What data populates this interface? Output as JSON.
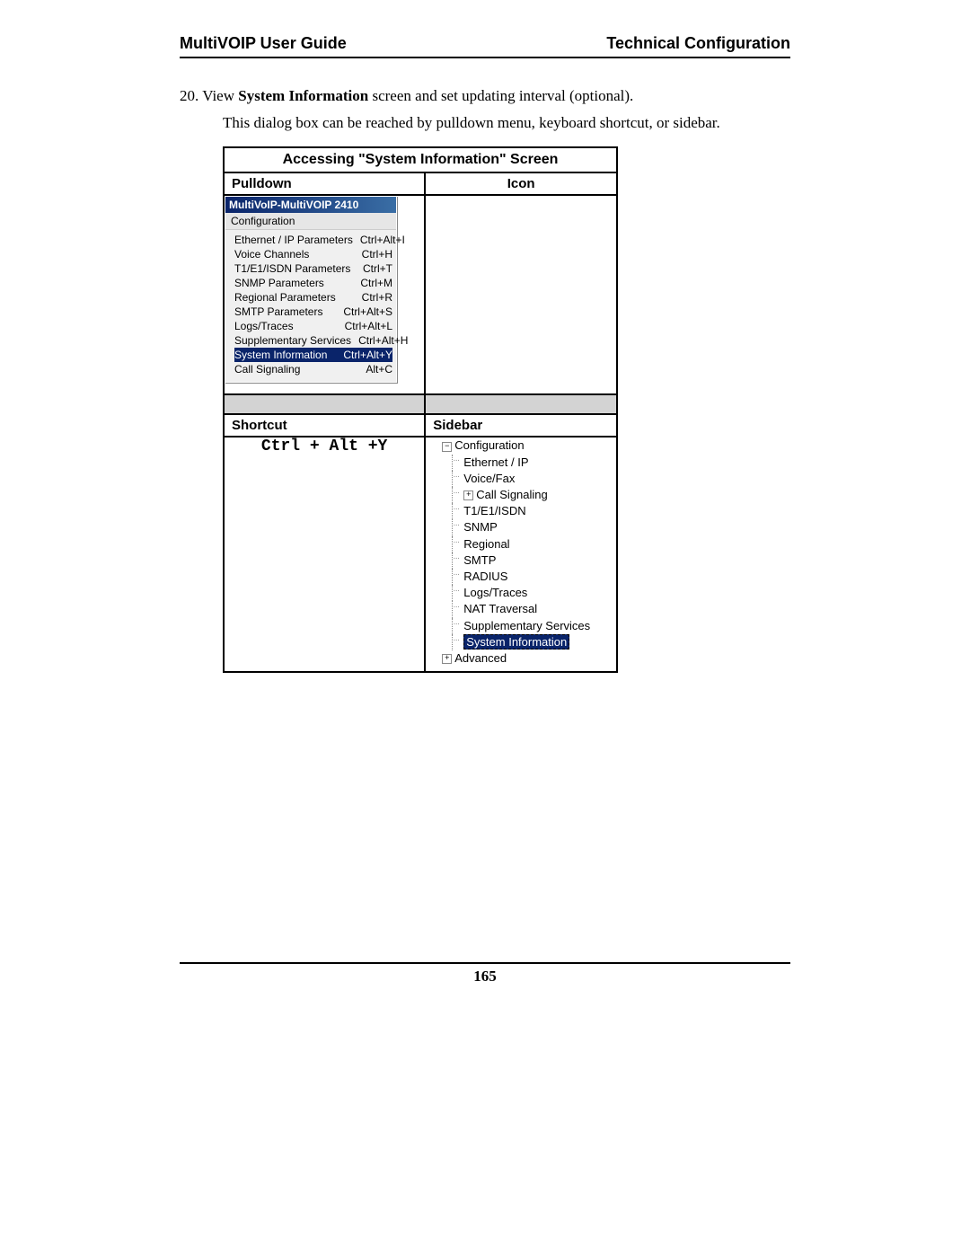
{
  "header": {
    "left": "MultiVOIP User Guide",
    "right": "Technical Configuration"
  },
  "step": {
    "number": "20.",
    "text_prefix": "View ",
    "bold": "System Information",
    "text_suffix": " screen and set updating interval (optional).",
    "desc": "This dialog box can be reached by pulldown menu, keyboard shortcut, or sidebar."
  },
  "table": {
    "caption": "Accessing \"System Information\" Screen",
    "heads": {
      "pulldown": "Pulldown",
      "icon": "Icon",
      "shortcut": "Shortcut",
      "sidebar": "Sidebar"
    },
    "shortcut_value": "Ctrl + Alt +Y"
  },
  "pulldown": {
    "title": "MultiVoIP-MultiVOIP 2410",
    "menu": "Configuration",
    "items": [
      {
        "label": "Ethernet / IP Parameters",
        "shortcut": "Ctrl+Alt+I",
        "selected": false
      },
      {
        "label": "Voice Channels",
        "shortcut": "Ctrl+H",
        "selected": false
      },
      {
        "label": "T1/E1/ISDN Parameters",
        "shortcut": "Ctrl+T",
        "selected": false
      },
      {
        "label": "SNMP Parameters",
        "shortcut": "Ctrl+M",
        "selected": false
      },
      {
        "label": "Regional Parameters",
        "shortcut": "Ctrl+R",
        "selected": false
      },
      {
        "label": "SMTP Parameters",
        "shortcut": "Ctrl+Alt+S",
        "selected": false
      },
      {
        "label": "Logs/Traces",
        "shortcut": "Ctrl+Alt+L",
        "selected": false
      },
      {
        "label": "Supplementary Services",
        "shortcut": "Ctrl+Alt+H",
        "selected": false
      },
      {
        "label": "System Information",
        "shortcut": "Ctrl+Alt+Y",
        "selected": true
      },
      {
        "label": "Call Signaling",
        "shortcut": "Alt+C",
        "selected": false
      }
    ]
  },
  "sidebar_tree": {
    "root": "Configuration",
    "children": [
      {
        "label": "Ethernet / IP",
        "expandable": false
      },
      {
        "label": "Voice/Fax",
        "expandable": false
      },
      {
        "label": "Call Signaling",
        "expandable": true
      },
      {
        "label": "T1/E1/ISDN",
        "expandable": false
      },
      {
        "label": "SNMP",
        "expandable": false
      },
      {
        "label": "Regional",
        "expandable": false
      },
      {
        "label": "SMTP",
        "expandable": false
      },
      {
        "label": "RADIUS",
        "expandable": false
      },
      {
        "label": "Logs/Traces",
        "expandable": false
      },
      {
        "label": "NAT Traversal",
        "expandable": false
      },
      {
        "label": "Supplementary Services",
        "expandable": false
      },
      {
        "label": "System Information",
        "expandable": false,
        "highlighted": true
      }
    ],
    "advanced": "Advanced"
  },
  "page_number": "165"
}
